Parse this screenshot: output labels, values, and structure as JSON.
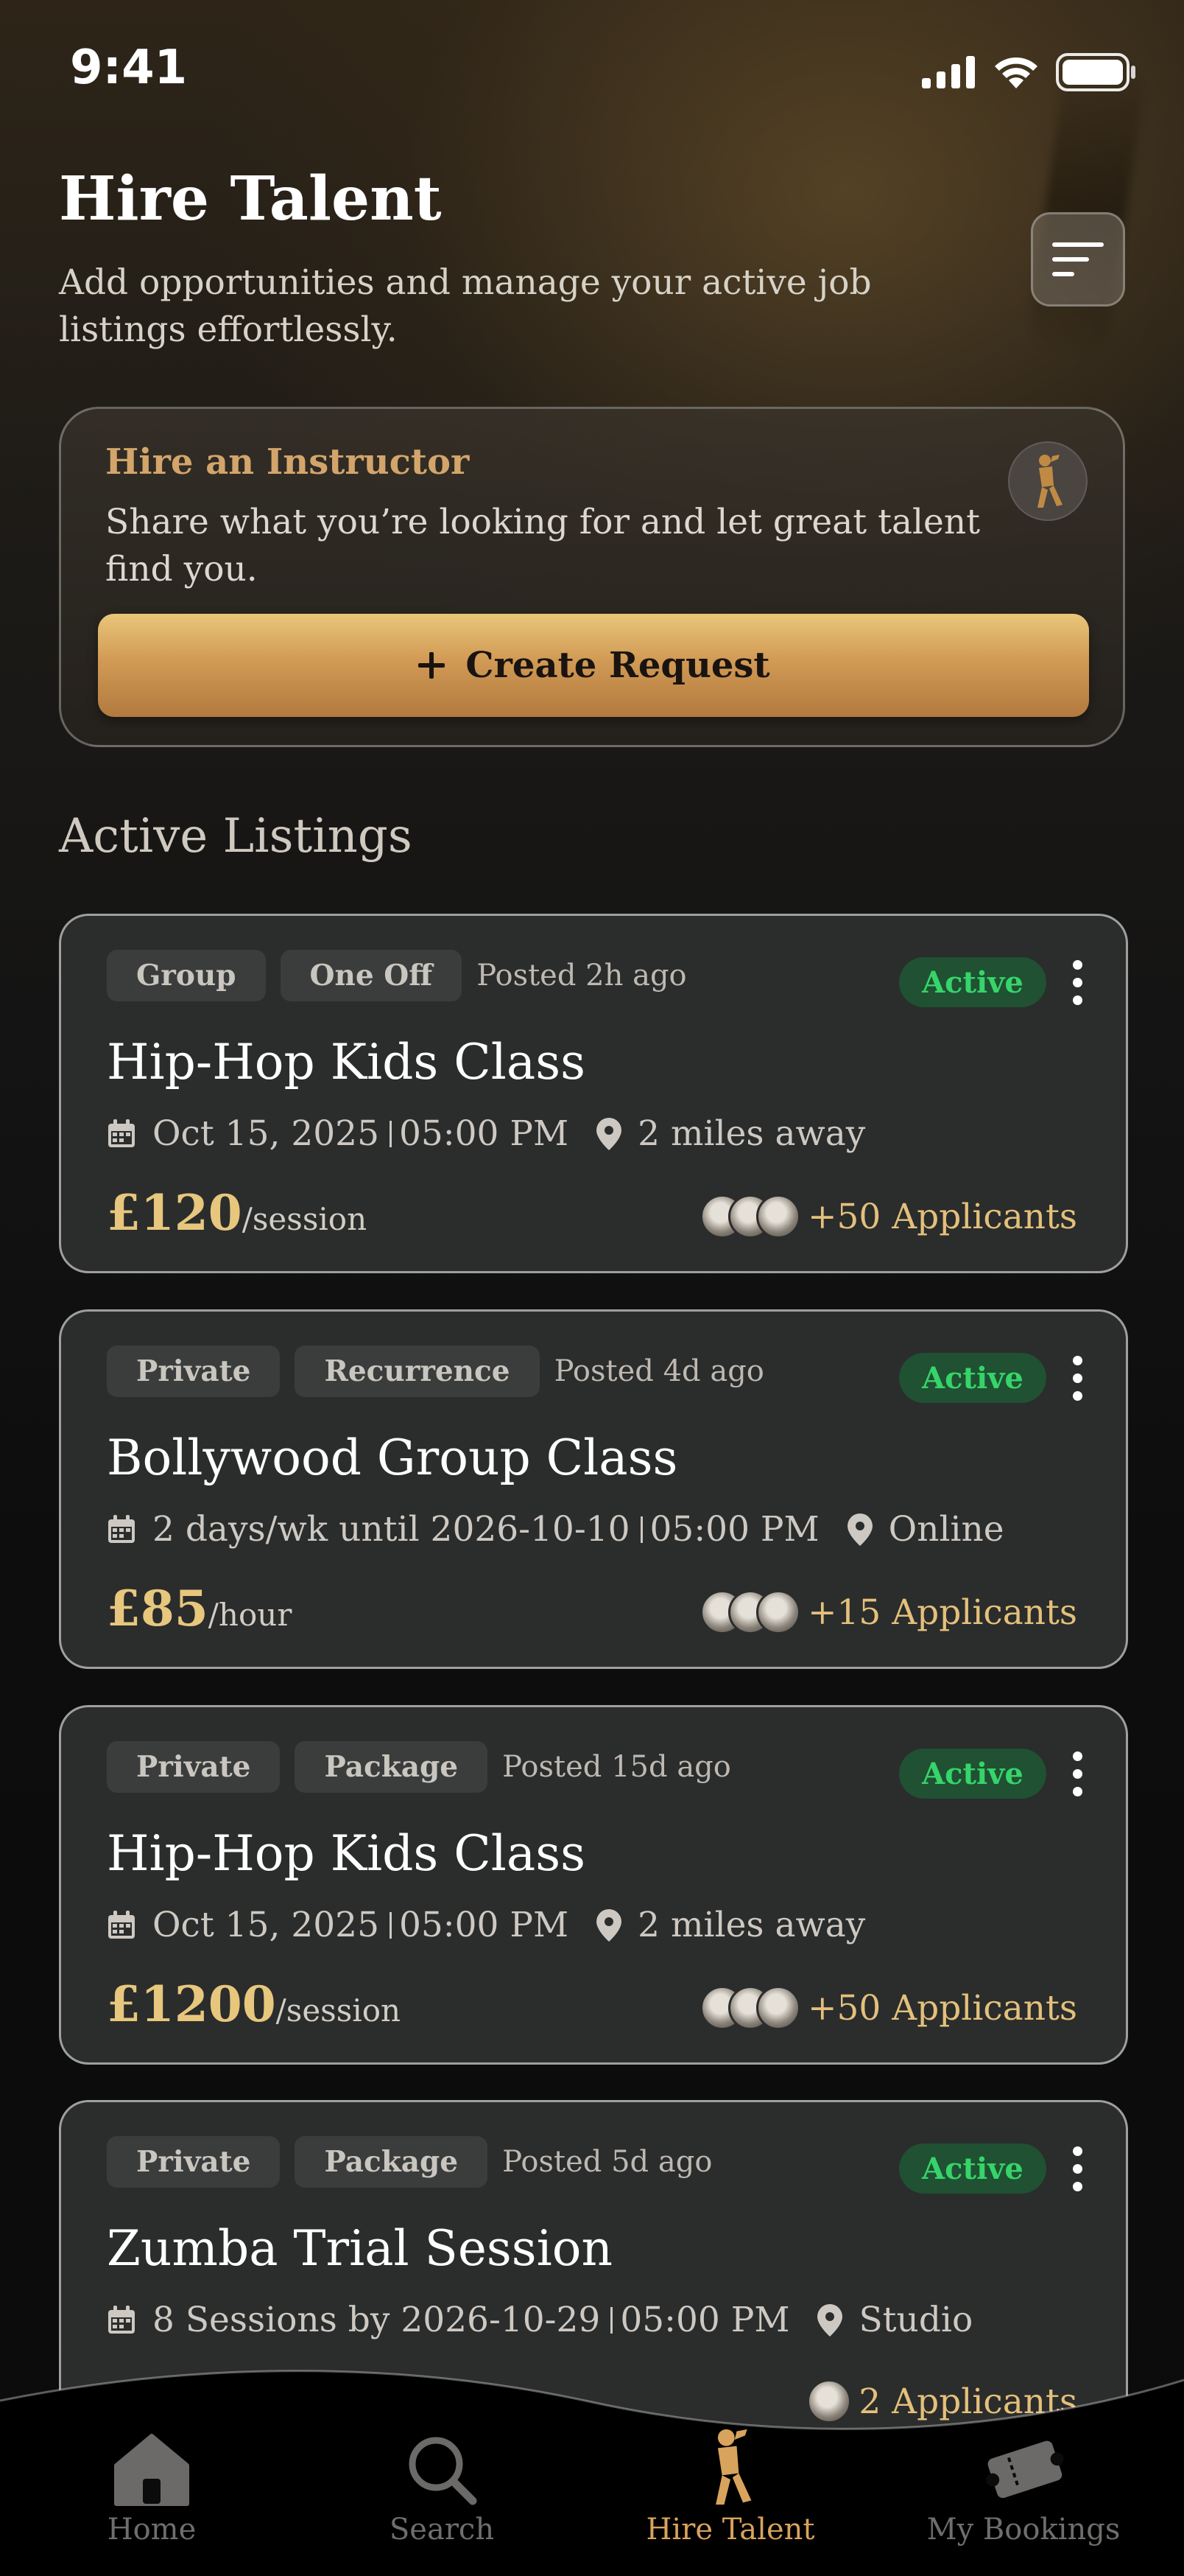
{
  "status_bar": {
    "time": "9:41"
  },
  "header": {
    "title": "Hire Talent",
    "subtitle": "Add opportunities and manage your active job listings effortlessly."
  },
  "hire_card": {
    "title": "Hire an Instructor",
    "description": "Share what you’re looking for and let great talent find you.",
    "button_label": "Create Request"
  },
  "section_title": "Active Listings",
  "listings": [
    {
      "tags": [
        "Group",
        "One Off"
      ],
      "posted": "Posted 2h ago",
      "status": "Active",
      "title": "Hip-Hop Kids Class",
      "date": "Oct 15, 2025",
      "time": "05:00 PM",
      "location": "2 miles away",
      "price": "£120",
      "price_unit": "/session",
      "applicants": "+50 Applicants"
    },
    {
      "tags": [
        "Private",
        "Recurrence"
      ],
      "posted": "Posted 4d ago",
      "status": "Active",
      "title": "Bollywood Group Class",
      "date": "2 days/wk until 2026-10-10",
      "time": "05:00 PM",
      "location": "Online",
      "price": "£85",
      "price_unit": "/hour",
      "applicants": "+15 Applicants"
    },
    {
      "tags": [
        "Private",
        "Package"
      ],
      "posted": "Posted 15d ago",
      "status": "Active",
      "title": "Hip-Hop Kids Class",
      "date": "Oct 15, 2025",
      "time": "05:00 PM",
      "location": "2 miles away",
      "price": "£1200",
      "price_unit": "/session",
      "applicants": "+50 Applicants"
    },
    {
      "tags": [
        "Private",
        "Package"
      ],
      "posted": "Posted 5d ago",
      "status": "Active",
      "title": "Zumba Trial Session",
      "date": "8 Sessions by 2026-10-29",
      "time": "05:00 PM",
      "location": "Studio",
      "applicants": "2 Applicants"
    }
  ],
  "bottom_nav": {
    "items": [
      {
        "label": "Home",
        "icon": "home-icon"
      },
      {
        "label": "Search",
        "icon": "search-icon"
      },
      {
        "label": "Hire Talent",
        "icon": "dancer-icon",
        "active": true
      },
      {
        "label": "My Bookings",
        "icon": "tickets-icon"
      }
    ]
  },
  "colors": {
    "accent_gold": "#d8a35c",
    "price_gold": "#e7c77d",
    "status_green": "#36d46a",
    "card_bg": "#2b2c2c"
  }
}
